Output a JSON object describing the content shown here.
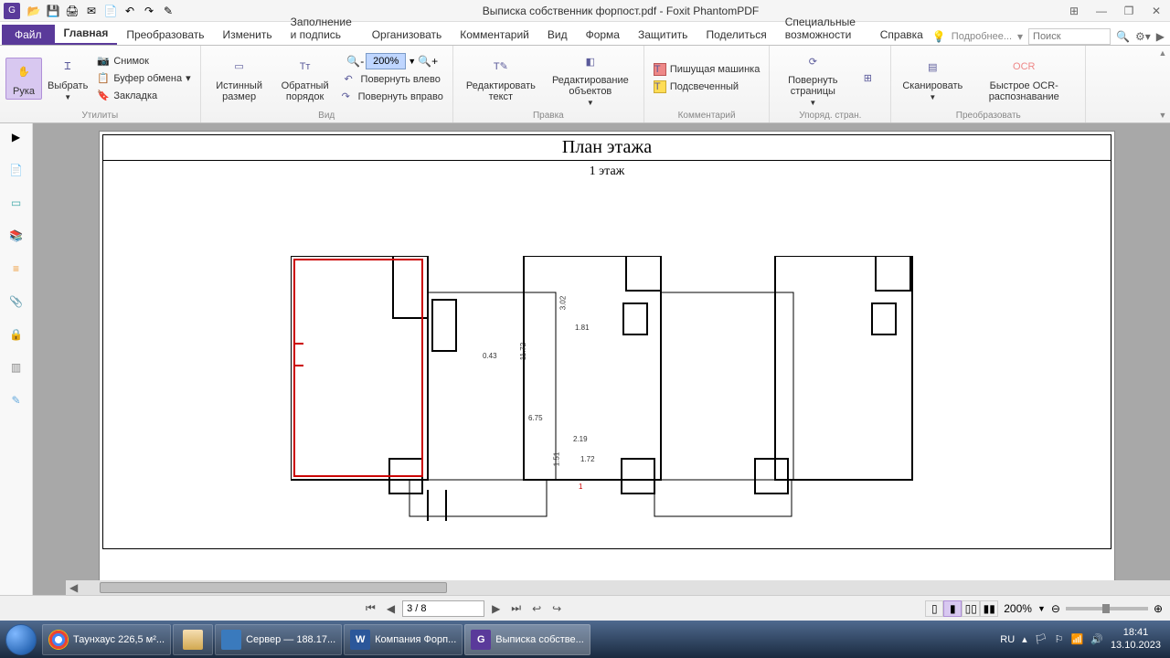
{
  "app": {
    "title": "Выписка собственник форпост.pdf - Foxit PhantomPDF",
    "logo": "G"
  },
  "qat": {
    "open": "📂",
    "save": "💾",
    "print": "🖨",
    "mail": "✉",
    "newdoc": "📄",
    "undo": "↶",
    "redo": "↷",
    "cursor": "✎"
  },
  "winctrl": {
    "arrange": "⊞",
    "min": "—",
    "restore": "❐",
    "close": "✕"
  },
  "tabs": {
    "file": "Файл",
    "items": [
      "Главная",
      "Преобразовать",
      "Изменить",
      "Заполнение и подпись",
      "Организовать",
      "Комментарий",
      "Вид",
      "Форма",
      "Защитить",
      "Поделиться",
      "Специальные возможности",
      "Справка"
    ],
    "tutorial": "Подробнее...",
    "search_placeholder": "Поиск"
  },
  "ribbon": {
    "hand": "Рука",
    "select": "Выбрать",
    "snapshot": "Снимок",
    "clipboard": "Буфер обмена",
    "bookmark": "Закладка",
    "utilgroup": "Утилиты",
    "actual": "Истинный размер",
    "reverse": "Обратный порядок",
    "zoom_value": "200%",
    "rotate_left": "Повернуть влево",
    "rotate_right": "Повернуть вправо",
    "viewgroup": "Вид",
    "edit_text": "Редактировать текст",
    "edit_obj": "Редактирование объектов",
    "editgroup": "Правка",
    "typewriter": "Пишущая машинка",
    "highlight": "Подсвеченный",
    "commentgroup": "Комментарий",
    "rotate_pages": "Повернуть страницы",
    "arrange_group": "Упоряд. стран.",
    "scan": "Сканировать",
    "ocr": "Быстрое OCR-распознавание",
    "convertgroup": "Преобразовать"
  },
  "doc": {
    "title": "План этажа",
    "subtitle": "1 этаж",
    "dims": {
      "d302": "3.02",
      "d181": "1.81",
      "d1172": "11.72",
      "d043": "0.43",
      "d675": "6.75",
      "d219": "2.19",
      "d151": "1.51",
      "d172": "1.72",
      "unit1": "1"
    }
  },
  "pager": {
    "page": "3 / 8",
    "zoom": "200%"
  },
  "tasks": {
    "chrome": "Таунхаус 226,5 м²...",
    "rdp": "Сервер — 188.17...",
    "word": "Компания Форп...",
    "pdf": "Выписка собстве..."
  },
  "tray": {
    "lang": "RU",
    "time": "18:41",
    "date": "13.10.2023"
  }
}
